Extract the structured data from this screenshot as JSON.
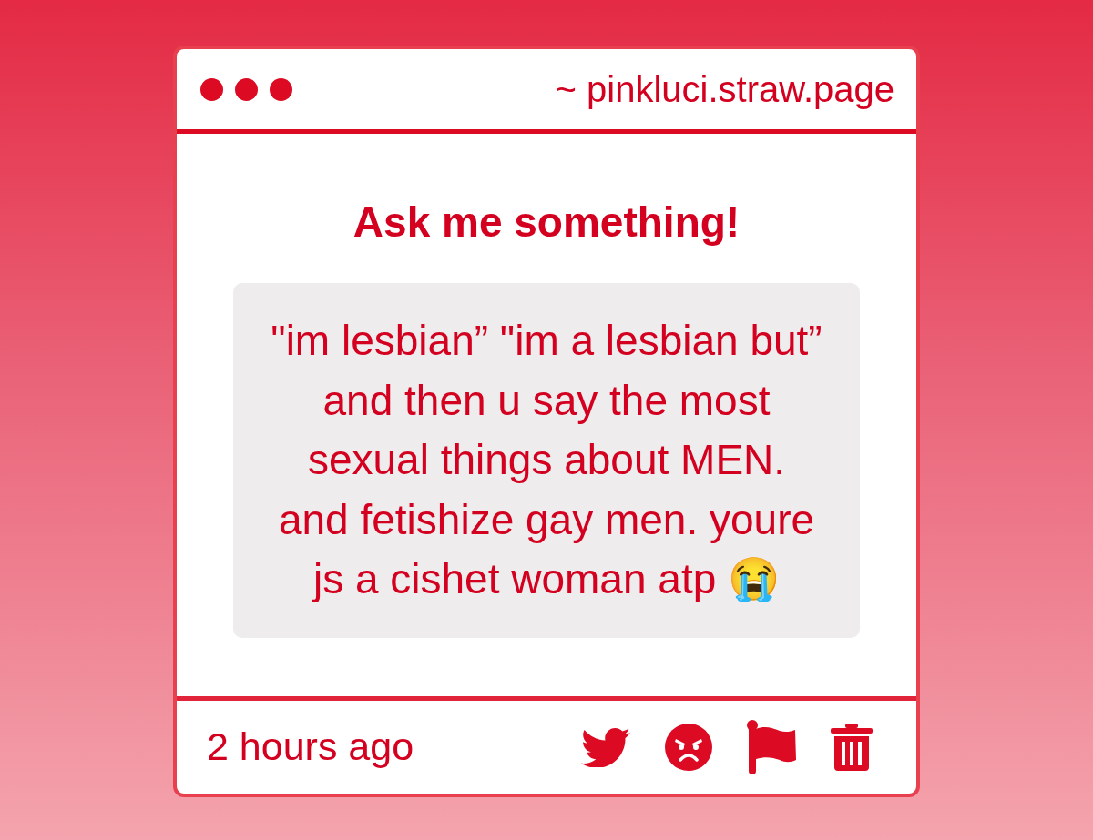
{
  "window": {
    "url": "~ pinkluci.straw.page"
  },
  "heading": "Ask me something!",
  "question": {
    "text": "\"im lesbian” \"im a lesbian but” and then u say the most sexual things about MEN. and fetishize gay men. youre js a cishet woman atp 😭"
  },
  "footer": {
    "time": "2 hours ago"
  }
}
